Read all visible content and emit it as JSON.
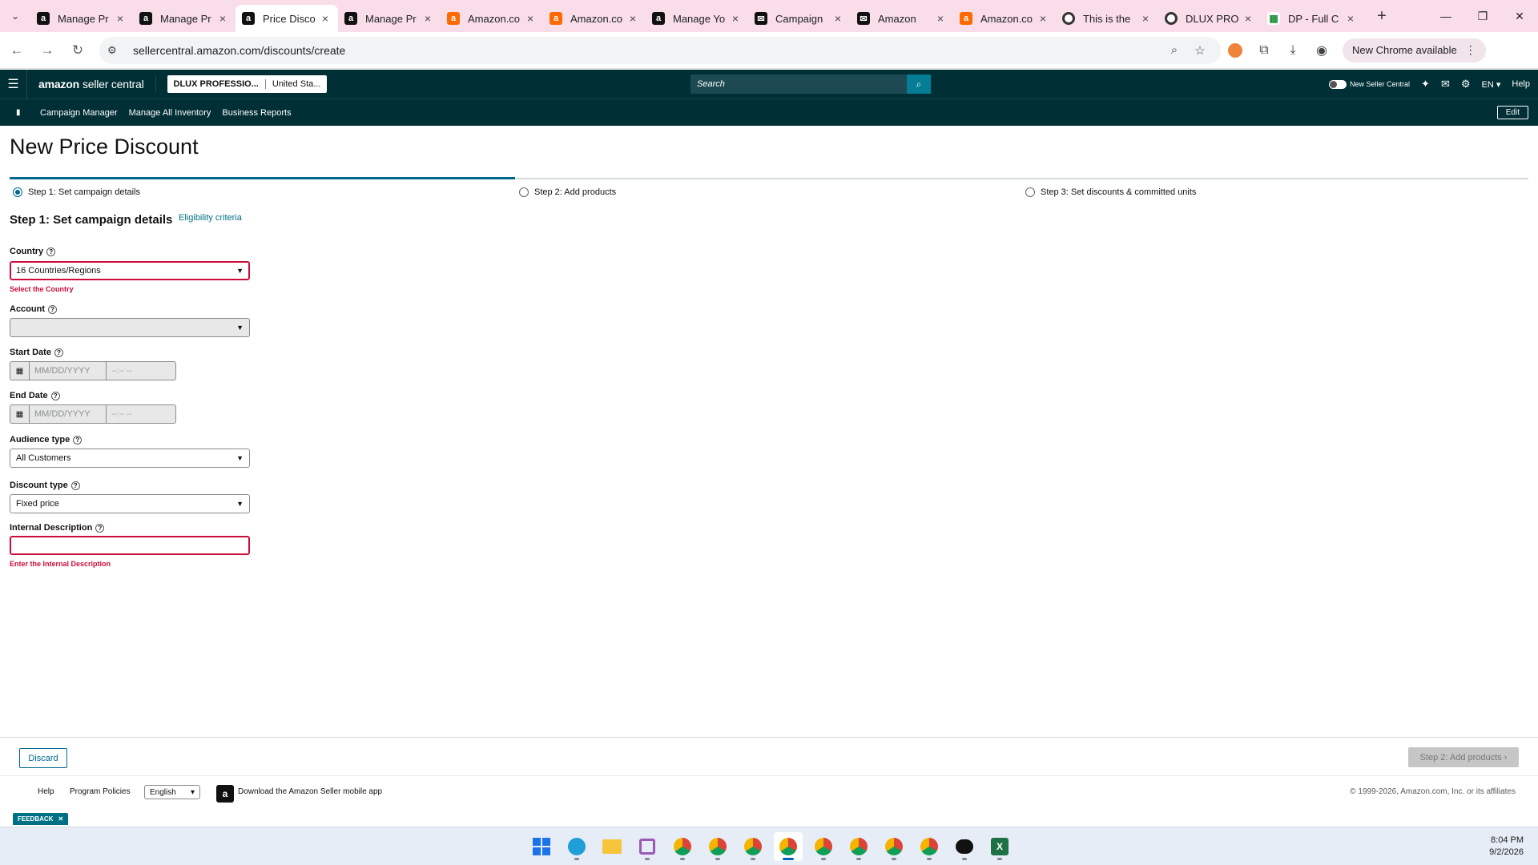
{
  "browser": {
    "tabs": [
      {
        "title": "Manage Pr",
        "favicon": "amazon-icon"
      },
      {
        "title": "Manage Pr",
        "favicon": "amazon-icon"
      },
      {
        "title": "Price Disco",
        "favicon": "amazon-icon",
        "active": true
      },
      {
        "title": "Manage Pr",
        "favicon": "amazon-icon"
      },
      {
        "title": "Amazon.co",
        "favicon": "amazon-orange-icon"
      },
      {
        "title": "Amazon.co",
        "favicon": "amazon-orange-icon"
      },
      {
        "title": "Manage Yo",
        "favicon": "amazon-icon"
      },
      {
        "title": "Campaign",
        "favicon": "mail-icon"
      },
      {
        "title": "Amazon",
        "favicon": "mail-icon"
      },
      {
        "title": "Amazon.co",
        "favicon": "amazon-orange-icon"
      },
      {
        "title": "This is the",
        "favicon": "globe-icon"
      },
      {
        "title": "DLUX PRO",
        "favicon": "globe-icon"
      },
      {
        "title": "DP - Full C",
        "favicon": "sheets-icon"
      }
    ],
    "url": "sellercentral.amazon.com/discounts/create",
    "chrome_available": "New Chrome available"
  },
  "header": {
    "logo_bold": "amazon",
    "logo_light": "seller central",
    "account_name": "DLUX PROFESSIO...",
    "account_region": "United Sta...",
    "search_placeholder": "Search",
    "new_seller_central": "New Seller Central",
    "language": "EN",
    "help": "Help"
  },
  "subnav": {
    "items": [
      "Campaign Manager",
      "Manage All Inventory",
      "Business Reports"
    ],
    "edit": "Edit"
  },
  "page": {
    "title": "New Price Discount",
    "steps": [
      "Step 1: Set campaign details",
      "Step 2: Add products",
      "Step 3: Set discounts & committed units"
    ],
    "current_step": 1,
    "progress_fraction": 0.333,
    "section_title": "Step 1: Set campaign details",
    "eligibility_link": "Eligibility criteria"
  },
  "form": {
    "country_label": "Country",
    "country_value": "16 Countries/Regions",
    "country_error": "Select the Country",
    "account_label": "Account",
    "account_value": "",
    "start_label": "Start Date",
    "start_date_placeholder": "MM/DD/YYYY",
    "start_time_placeholder": "--:-- --",
    "end_label": "End Date",
    "end_date_placeholder": "MM/DD/YYYY",
    "end_time_placeholder": "--:-- --",
    "audience_label": "Audience type",
    "audience_value": "All Customers",
    "discount_label": "Discount type",
    "discount_value": "Fixed price",
    "desc_label": "Internal Description",
    "desc_error": "Enter the Internal Description"
  },
  "actions": {
    "discard": "Discard",
    "next": "Step 2: Add products"
  },
  "footer": {
    "help": "Help",
    "policies": "Program Policies",
    "language": "English",
    "app": "Download the Amazon Seller mobile app",
    "copyright": "© 1999-2026, Amazon.com, Inc. or its affiliates",
    "feedback": "FEEDBACK"
  },
  "taskbar": {
    "time": "8:04 PM",
    "date": "9/2/2026"
  },
  "colors": {
    "header_bg": "#002f36",
    "accent": "#00688f",
    "error": "#cc0c39",
    "tabstrip_bg": "#f9dde8"
  }
}
